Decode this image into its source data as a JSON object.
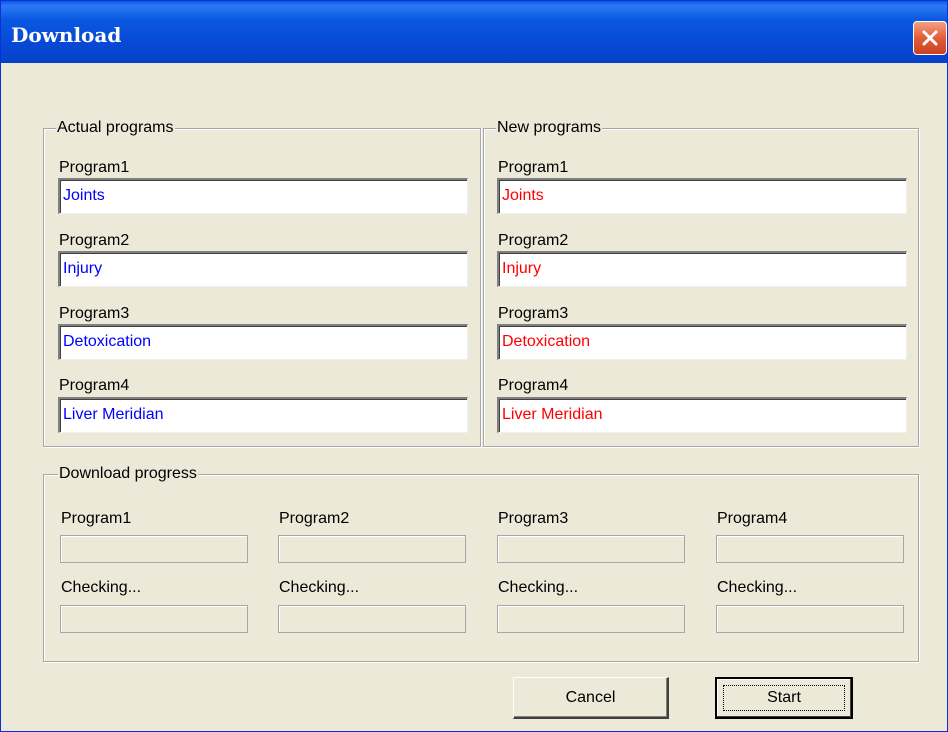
{
  "window": {
    "title": "Download",
    "close_icon": "close-icon"
  },
  "actual_programs": {
    "group_label": "Actual programs",
    "items": [
      {
        "label": "Program1",
        "value": "Joints"
      },
      {
        "label": "Program2",
        "value": "Injury"
      },
      {
        "label": "Program3",
        "value": "Detoxication"
      },
      {
        "label": "Program4",
        "value": "Liver Meridian"
      }
    ],
    "text_color": "#0000ff"
  },
  "new_programs": {
    "group_label": "New programs",
    "items": [
      {
        "label": "Program1",
        "value": "Joints"
      },
      {
        "label": "Program2",
        "value": "Injury"
      },
      {
        "label": "Program3",
        "value": "Detoxication"
      },
      {
        "label": "Program4",
        "value": "Liver Meridian"
      }
    ],
    "text_color": "#ff0000"
  },
  "download_progress": {
    "group_label": "Download progress",
    "columns": [
      {
        "label": "Program1",
        "check_label": "Checking..."
      },
      {
        "label": "Program2",
        "check_label": "Checking..."
      },
      {
        "label": "Program3",
        "check_label": "Checking..."
      },
      {
        "label": "Program4",
        "check_label": "Checking..."
      }
    ]
  },
  "buttons": {
    "cancel_label": "Cancel",
    "start_label": "Start"
  }
}
